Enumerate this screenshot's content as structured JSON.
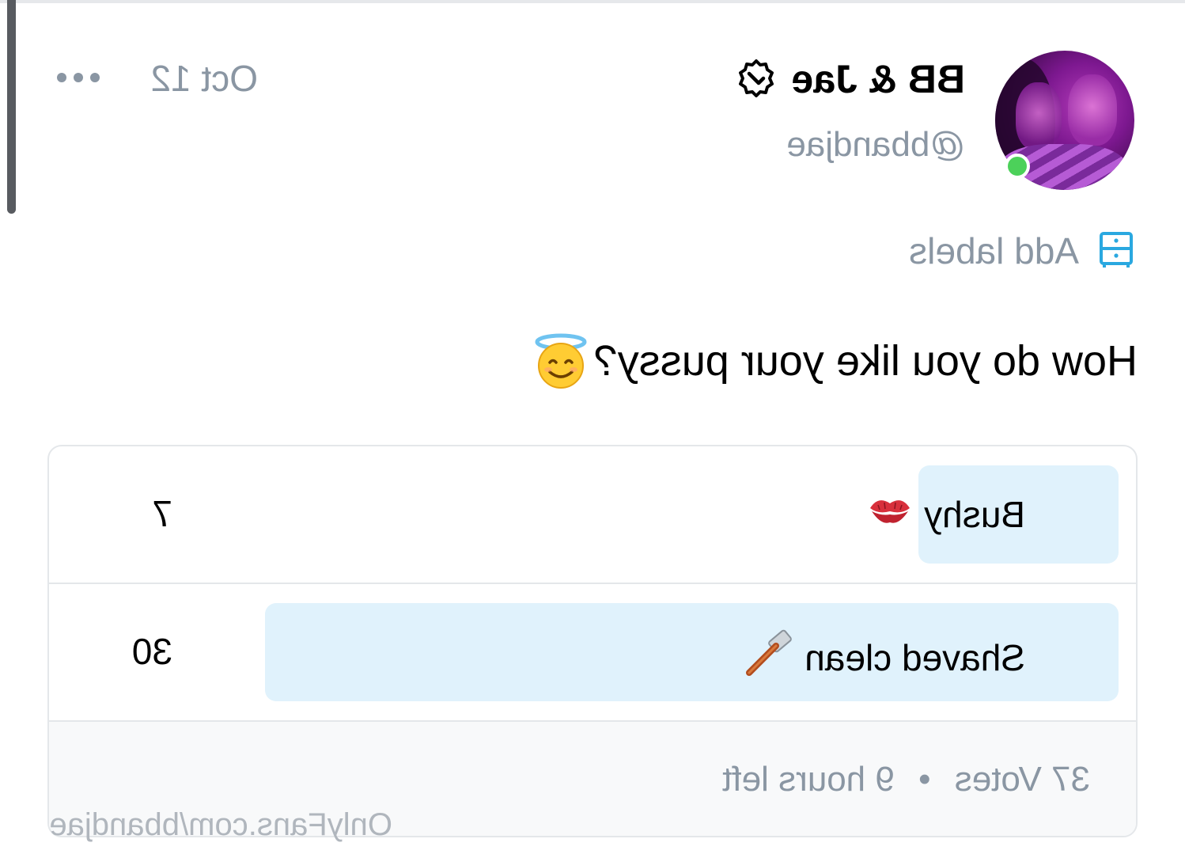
{
  "post": {
    "author": {
      "display_name": "BB & Jae",
      "handle": "@bbandjae",
      "verified_icon": "verified-badge-icon",
      "online": true
    },
    "date": "Oct 12",
    "labels_action": "Add labels",
    "text": "How do you like your pussy?",
    "text_emoji": "smiling-face-with-halo",
    "poll": {
      "options": [
        {
          "label": "Bushy",
          "emoji": "kiss-mark",
          "votes": "7"
        },
        {
          "label": "Shaved clean",
          "emoji": "razor",
          "votes": "30"
        }
      ],
      "votes_summary": "37 Votes",
      "separator": "•",
      "time_left": "9 hours left",
      "vote_fractions": [
        0.19,
        0.81
      ]
    }
  },
  "watermark": "OnlyFans.com/bbandjae",
  "colors": {
    "muted_text": "#8a96a3",
    "accent": "#00aff0",
    "poll_fill": "#e0f2fc",
    "online": "#4cd15a"
  }
}
